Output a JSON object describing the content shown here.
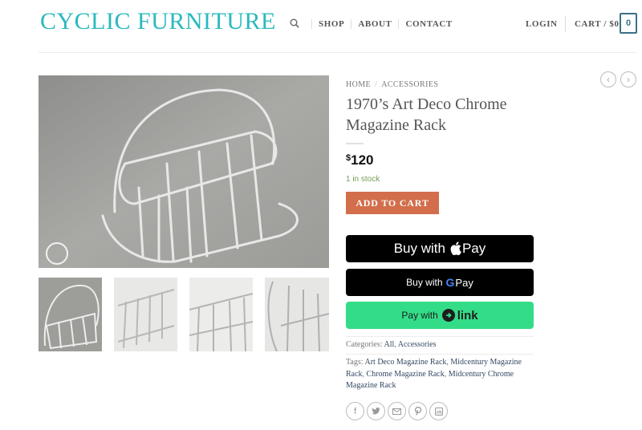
{
  "header": {
    "logo": "CYCLIC FURNITURE",
    "nav": [
      "SHOP",
      "ABOUT",
      "CONTACT"
    ],
    "login": "LOGIN",
    "cart_label": "CART / $0",
    "cart_count": "0"
  },
  "breadcrumb": [
    "HOME",
    "ACCESSORIES"
  ],
  "product": {
    "title": "1970’s Art Deco Chrome Magazine Rack",
    "price_currency": "$",
    "price_amount": "120",
    "stock": "1 in stock",
    "add_to_cart": "ADD TO CART"
  },
  "payments": {
    "apple_text": "Buy with",
    "apple_brand": "Pay",
    "google_text": "Buy with",
    "google_g": "G",
    "google_brand": "Pay",
    "link_text": "Pay with",
    "link_brand": "link"
  },
  "meta": {
    "categories_label": "Categories:",
    "categories": [
      "All",
      "Accessories"
    ],
    "tags_label": "Tags:",
    "tags": [
      "Art Deco Magazine Rack",
      "Midcentury Magazine Rack",
      "Chrome Magazine Rack",
      "Midcentury Chrome Magazine Rack"
    ]
  },
  "social_icons": [
    "facebook-icon",
    "twitter-icon",
    "email-icon",
    "pinterest-icon",
    "linkedin-icon"
  ],
  "colors": {
    "logo": "#2bb9bd",
    "add_to_cart": "#d26e4b",
    "link_button": "#33dd88",
    "in_stock": "#7a9c59"
  }
}
